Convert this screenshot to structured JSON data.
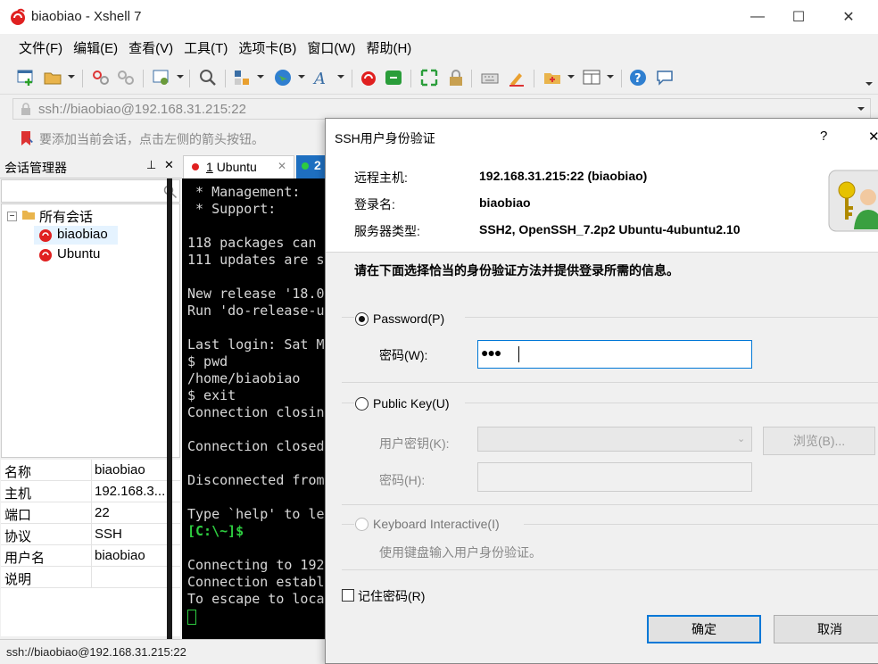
{
  "window": {
    "title": "biaobiao - Xshell 7",
    "minimize": "—",
    "maximize": "☐",
    "close": "✕"
  },
  "menu": [
    "文件(F)",
    "编辑(E)",
    "查看(V)",
    "工具(T)",
    "选项卡(B)",
    "窗口(W)",
    "帮助(H)"
  ],
  "toolbar_icons": [
    "new-session-icon",
    "open-folder-icon",
    "disconnect-icon",
    "reconnect-icon",
    "properties-icon",
    "find-icon",
    "transfer-icon",
    "globe-icon",
    "font-icon",
    "xshell-icon",
    "xftp-icon",
    "fullscreen-icon",
    "lock-icon",
    "keyboard-icon",
    "highlight-icon",
    "compose-icon",
    "layout-icon",
    "help-icon",
    "chat-icon"
  ],
  "address": {
    "value": "ssh://biaobiao@192.168.31.215:22"
  },
  "hint": {
    "text": "要添加当前会话，点击左侧的箭头按钮。"
  },
  "session_manager": {
    "title": "会话管理器",
    "tree": {
      "root": "所有会话",
      "items": [
        "biaobiao",
        "Ubuntu"
      ]
    },
    "properties": [
      {
        "key": "名称",
        "value": "biaobiao"
      },
      {
        "key": "主机",
        "value": "192.168.3..."
      },
      {
        "key": "端口",
        "value": "22"
      },
      {
        "key": "协议",
        "value": "SSH"
      },
      {
        "key": "用户名",
        "value": "biaobiao"
      },
      {
        "key": "说明",
        "value": ""
      }
    ]
  },
  "tabs": [
    {
      "label": "1 Ubuntu",
      "number": "1",
      "name": "Ubuntu"
    },
    {
      "label": "2"
    }
  ],
  "terminal": {
    "lines": [
      " * Management:",
      " * Support:",
      "",
      "118 packages can ",
      "111 updates are s",
      "",
      "New release '18.0",
      "Run 'do-release-u",
      "",
      "Last login: Sat M",
      "$ pwd",
      "/home/biaobiao",
      "$ exit",
      "Connection closin",
      "",
      "Connection closed",
      "",
      "Disconnected from",
      "",
      "Type `help' to le",
      "[C:\\~]$",
      "",
      "Connecting to 192",
      "Connection establ",
      "To escape to loca"
    ],
    "prompt_color": "#2ecc40"
  },
  "status": {
    "text": "ssh://biaobiao@192.168.31.215:22"
  },
  "dialog": {
    "title": "SSH用户身份验证",
    "help": "?",
    "close": "✕",
    "remote_host_label": "远程主机:",
    "remote_host_value": "192.168.31.215:22 (biaobiao)",
    "login_label": "登录名:",
    "login_value": "biaobiao",
    "server_type_label": "服务器类型:",
    "server_type_value": "SSH2, OpenSSH_7.2p2 Ubuntu-4ubuntu2.10",
    "instruction": "请在下面选择恰当的身份验证方法并提供登录所需的信息。",
    "password_option": "Password(P)",
    "password_label": "密码(W):",
    "password_value": "●●●",
    "publickey_option": "Public Key(U)",
    "user_key_label": "用户密钥(K):",
    "browse_button": "浏览(B)...",
    "passphrase_label": "密码(H):",
    "keyboard_option": "Keyboard Interactive(I)",
    "keyboard_desc": "使用键盘输入用户身份验证。",
    "remember_password": "记住密码(R)",
    "ok_button": "确定",
    "cancel_button": "取消"
  }
}
